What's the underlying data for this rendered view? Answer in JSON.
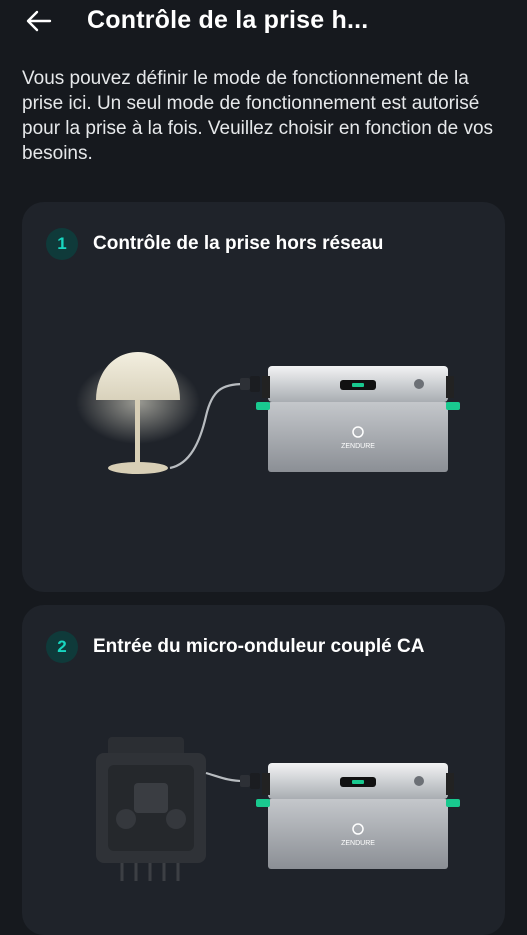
{
  "header": {
    "back_icon": "arrow-left-icon",
    "title": "Contrôle de la prise h..."
  },
  "intro_text": "Vous pouvez définir le mode de fonctionnement de la prise ici. Un seul mode de fonctionnement est autorisé pour la prise à la fois. Veuillez choisir en fonction de vos besoins.",
  "modes": [
    {
      "number": "1",
      "title": "Contrôle de la prise hors réseau",
      "illustration": "lamp-connected-to-battery",
      "battery_brand": "ZENDURE"
    },
    {
      "number": "2",
      "title": "Entrée du micro-onduleur couplé CA",
      "illustration": "microinverter-connected-to-battery",
      "battery_brand": "ZENDURE"
    }
  ],
  "colors": {
    "background": "#16191e",
    "card": "#1f232a",
    "accent": "#18d6c0",
    "badge_bg": "#0f3a3a",
    "battery_handle": "#19c98f"
  }
}
